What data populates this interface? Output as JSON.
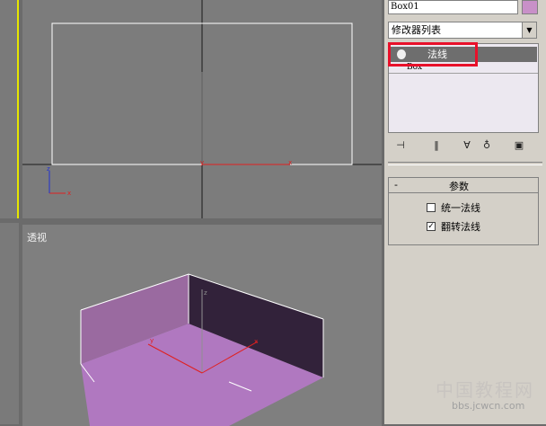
{
  "object_name": "Box01",
  "object_color": "#c890c8",
  "modifier_list": {
    "label": "修改器列表",
    "arrow": "chevron-down-icon"
  },
  "stack": {
    "selected_modifier": "法线",
    "base_object": "Box"
  },
  "highlight_color": "#e8102a",
  "rollout": {
    "collapse_symbol": "-",
    "title": "参数",
    "options": [
      {
        "label": "统一法线",
        "checked": false
      },
      {
        "label": "翻转法线",
        "checked": true
      }
    ]
  },
  "viewports": {
    "perspective_label": "透视"
  },
  "watermark": {
    "title": "中国教程网",
    "url": "bbs.jcwcn.com"
  }
}
